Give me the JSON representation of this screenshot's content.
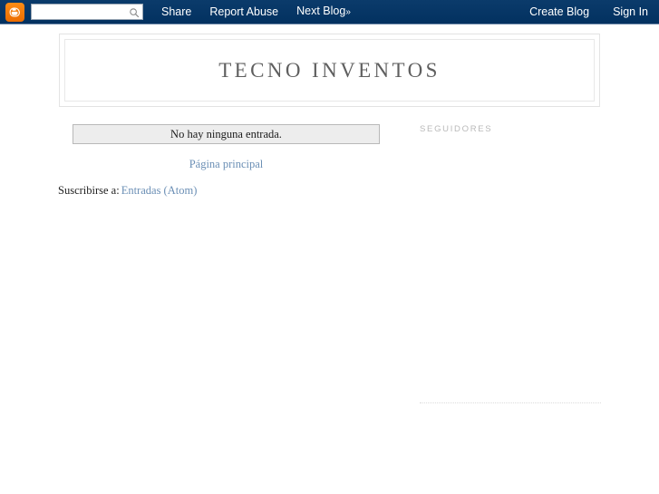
{
  "navbar": {
    "logo_icon": "blogger-b-icon",
    "search": {
      "value": "",
      "placeholder": "",
      "icon": "search-icon"
    },
    "left_links": [
      {
        "label": "Share",
        "name": "share"
      },
      {
        "label": "Report Abuse",
        "name": "report-abuse"
      }
    ],
    "next_blog": {
      "label": "Next Blog",
      "chevron": "»"
    },
    "right_links": [
      {
        "label": "Create Blog",
        "name": "create-blog"
      },
      {
        "label": "Sign In",
        "name": "sign-in"
      }
    ],
    "background_color": "#0a3a68",
    "text_color": "#ffffff",
    "logo_color": "#f57d00"
  },
  "header": {
    "blog_title": "TECNO INVENTOS"
  },
  "main": {
    "status_message": "No hay ninguna entrada.",
    "home_link": "Página principal",
    "subscribe_prefix": "Suscribirse a:",
    "subscribe_link": "Entradas (Atom)",
    "link_color": "#6b8fb5"
  },
  "sidebar": {
    "followers_heading": "SEGUIDORES",
    "heading_color": "#b9b9b9"
  }
}
